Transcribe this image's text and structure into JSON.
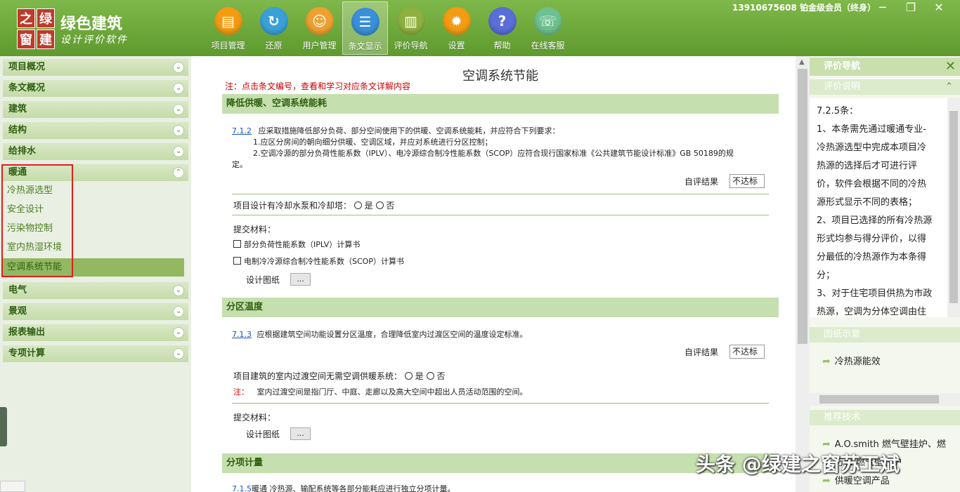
{
  "app": {
    "logo_chars": [
      "之",
      "绿",
      "窗",
      "建"
    ],
    "title": "绿色建筑",
    "subtitle": "设计评价软件"
  },
  "toolbar": [
    {
      "label": "项目管理",
      "icon": "folder-icon",
      "color": "#f39c12",
      "glyph": "▤"
    },
    {
      "label": "还原",
      "icon": "restore-icon",
      "color": "#3aa0d8",
      "glyph": "↻"
    },
    {
      "label": "用户管理",
      "icon": "user-icon",
      "color": "#f0a030",
      "glyph": "☺"
    },
    {
      "label": "条文显示",
      "icon": "clipboard-icon",
      "color": "#3a8fd8",
      "glyph": "☰"
    },
    {
      "label": "评价导航",
      "icon": "book-icon",
      "color": "#8fb040",
      "glyph": "▥"
    },
    {
      "label": "设置",
      "icon": "gear-icon",
      "color": "#f39c12",
      "glyph": "✹"
    },
    {
      "label": "帮助",
      "icon": "help-icon",
      "color": "#5a6ed8",
      "glyph": "?"
    },
    {
      "label": "在线客服",
      "icon": "support-icon",
      "color": "#6ec090",
      "glyph": "☏"
    }
  ],
  "user_info": "13910675608 铂金级会员（终身）",
  "sidebar": {
    "sections_top": [
      "项目概况",
      "条文概况",
      "建筑",
      "结构",
      "给排水",
      "暖通"
    ],
    "hvac_items": [
      "冷热源选型",
      "安全设计",
      "污染物控制",
      "室内热湿环境",
      "空调系统节能"
    ],
    "sections_bottom": [
      "电气",
      "景观",
      "报表输出",
      "专项计算"
    ]
  },
  "main": {
    "title": "空调系统节能",
    "note": "注：点击条文编号，查看和学习对应条文详解内容",
    "sec1": {
      "heading": "降低供暖、空调系统能耗",
      "code": "7.1.2",
      "line1": "应采取措施降低部分负荷、部分空间使用下的供暖、空调系统能耗，并应符合下列要求：",
      "line2": "1.应区分房间的朝向细分供暖、空调区域，并应对系统进行分区控制；",
      "line3": "2.空调冷源的部分负荷性能系数（IPLV）、电冷源综合制冷性能系数（SCOP）应符合现行国家标准《公共建筑节能设计标准》GB 50189的规",
      "line4": "定。",
      "result_label": "自评结果",
      "result_value": "不达标",
      "question": "项目设计有冷却水泵和冷却塔：",
      "yes": "是",
      "no": "否",
      "materials_label": "提交材料：",
      "mat1": "部分负荷性能系数（IPLV）计算书",
      "mat2": "电制冷冷源综合制冷性能系数（SCOP）计算书",
      "drawing_label": "设计图纸",
      "dots": "..."
    },
    "sec2": {
      "heading": "分区温度",
      "code": "7.1.3",
      "line1": "应根据建筑空间功能设置分区温度，合理降低室内过渡区空间的温度设定标准。",
      "result_label": "自评结果",
      "result_value": "不达标",
      "question": "项目建筑的室内过渡空间无需空调供暖系统：",
      "yes": "是",
      "no": "否",
      "note_label": "注：",
      "note_text": "室内过渡空间是指门厅、中庭、走廊以及高大空间中超出人员活动范围的空间。",
      "materials_label": "提交材料：",
      "drawing_label": "设计图纸",
      "dots": "..."
    },
    "sec3": {
      "heading": "分项计量",
      "code": "7.1.5",
      "line1": "暖通 冷热源、输配系统等各部分能耗应进行独立分项计量。"
    }
  },
  "right_panel": {
    "heading": "评价导航",
    "desc_heading": "评价说明",
    "desc_lines": [
      "7.2.5条：",
      "1、本条需先通过暖通专业-",
      "冷热源选型中完成本项目冷",
      "热源的选择后才可进行评",
      "价，软件会根据不同的冷热",
      "源形式显示不同的表格；",
      "2、项目已选择的所有冷热源",
      "形式均参与得分评价，以得",
      "分最低的冷热源作为本条得",
      "分；",
      "3、对于住宅项目供热为市政",
      "热源，空调为分体空调由住"
    ],
    "drawing_heading": "图纸示意",
    "drawing_link": "冷热源能效",
    "tech_heading": "推荐技术",
    "tech_link1": "A.O.smith 燃气壁挂炉、燃",
    "tech_link2": "万和 燃气壁挂炉",
    "tech_link3": "供暖空调产品"
  },
  "watermark": "头条 @绿建之窗苏工斌"
}
